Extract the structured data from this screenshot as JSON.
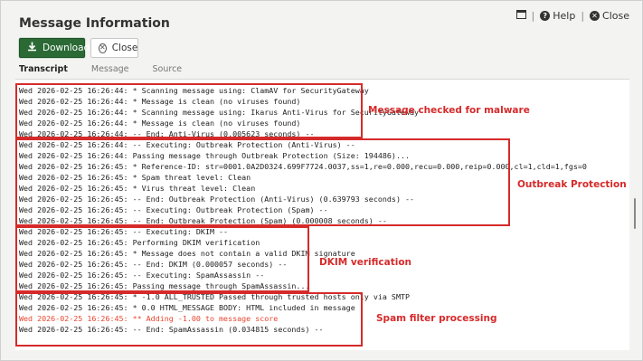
{
  "dialog": {
    "title": "Message Information",
    "help_label": "Help",
    "close_label": "Close"
  },
  "toolbar": {
    "download_label": "Download",
    "close_label": "Close"
  },
  "tabs": [
    {
      "label": "Transcript",
      "active": true
    },
    {
      "label": "Message",
      "active": false
    },
    {
      "label": "Source",
      "active": false
    }
  ],
  "log_lines": [
    {
      "text": "Wed 2026-02-25 16:26:44: * Scanning message using: ClamAV for SecurityGateway",
      "warn": false
    },
    {
      "text": "Wed 2026-02-25 16:26:44: * Message is clean (no viruses found)",
      "warn": false
    },
    {
      "text": "Wed 2026-02-25 16:26:44: * Scanning message using: Ikarus Anti-Virus for SecurityGateway",
      "warn": false
    },
    {
      "text": "Wed 2026-02-25 16:26:44: * Message is clean (no viruses found)",
      "warn": false
    },
    {
      "text": "Wed 2026-02-25 16:26:44: -- End: Anti-Virus (0.005623 seconds) --",
      "warn": false
    },
    {
      "text": "Wed 2026-02-25 16:26:44: -- Executing: Outbreak Protection (Anti-Virus) --",
      "warn": false
    },
    {
      "text": "Wed 2026-02-25 16:26:44: Passing message through Outbreak Protection (Size: 194486)...",
      "warn": false
    },
    {
      "text": "Wed 2026-02-25 16:26:45: * Reference-ID: str=0001.0A2D0324.699F7724.0037,ss=1,re=0.000,recu=0.000,reip=0.000,cl=1,cld=1,fgs=0",
      "warn": false
    },
    {
      "text": "Wed 2026-02-25 16:26:45: * Spam threat level: Clean",
      "warn": false
    },
    {
      "text": "Wed 2026-02-25 16:26:45: * Virus threat level: Clean",
      "warn": false
    },
    {
      "text": "Wed 2026-02-25 16:26:45: -- End: Outbreak Protection (Anti-Virus) (0.639793 seconds) --",
      "warn": false
    },
    {
      "text": "Wed 2026-02-25 16:26:45: -- Executing: Outbreak Protection (Spam) --",
      "warn": false
    },
    {
      "text": "Wed 2026-02-25 16:26:45: -- End: Outbreak Protection (Spam) (0.000008 seconds) --",
      "warn": false
    },
    {
      "text": "Wed 2026-02-25 16:26:45: -- Executing: DKIM --",
      "warn": false
    },
    {
      "text": "Wed 2026-02-25 16:26:45: Performing DKIM verification",
      "warn": false
    },
    {
      "text": "Wed 2026-02-25 16:26:45: * Message does not contain a valid DKIM signature",
      "warn": false
    },
    {
      "text": "Wed 2026-02-25 16:26:45: -- End: DKIM (0.000057 seconds) --",
      "warn": false
    },
    {
      "text": "Wed 2026-02-25 16:26:45: -- Executing: SpamAssassin --",
      "warn": false
    },
    {
      "text": "Wed 2026-02-25 16:26:45: Passing message through SpamAssassin...",
      "warn": false
    },
    {
      "text": "Wed 2026-02-25 16:26:45: * -1.0 ALL_TRUSTED Passed through trusted hosts only via SMTP",
      "warn": false
    },
    {
      "text": "Wed 2026-02-25 16:26:45: * 0.0 HTML_MESSAGE BODY: HTML included in message",
      "warn": false
    },
    {
      "text": "Wed 2026-02-25 16:26:45: ** Adding -1.00 to message score",
      "warn": true
    },
    {
      "text": "Wed 2026-02-25 16:26:45: -- End: SpamAssassin (0.034815 seconds) --",
      "warn": false
    }
  ],
  "annotations": [
    {
      "label": "Message checked for malware"
    },
    {
      "label": "Outbreak Protection"
    },
    {
      "label": "DKIM verification"
    },
    {
      "label": "Spam filter processing"
    }
  ],
  "colors": {
    "accent": "#2b6a35",
    "annotation": "#d62a2a",
    "warning_text": "#e8462e"
  },
  "icons": [
    "window-icon",
    "help-icon",
    "close-circle-icon",
    "download-icon"
  ]
}
